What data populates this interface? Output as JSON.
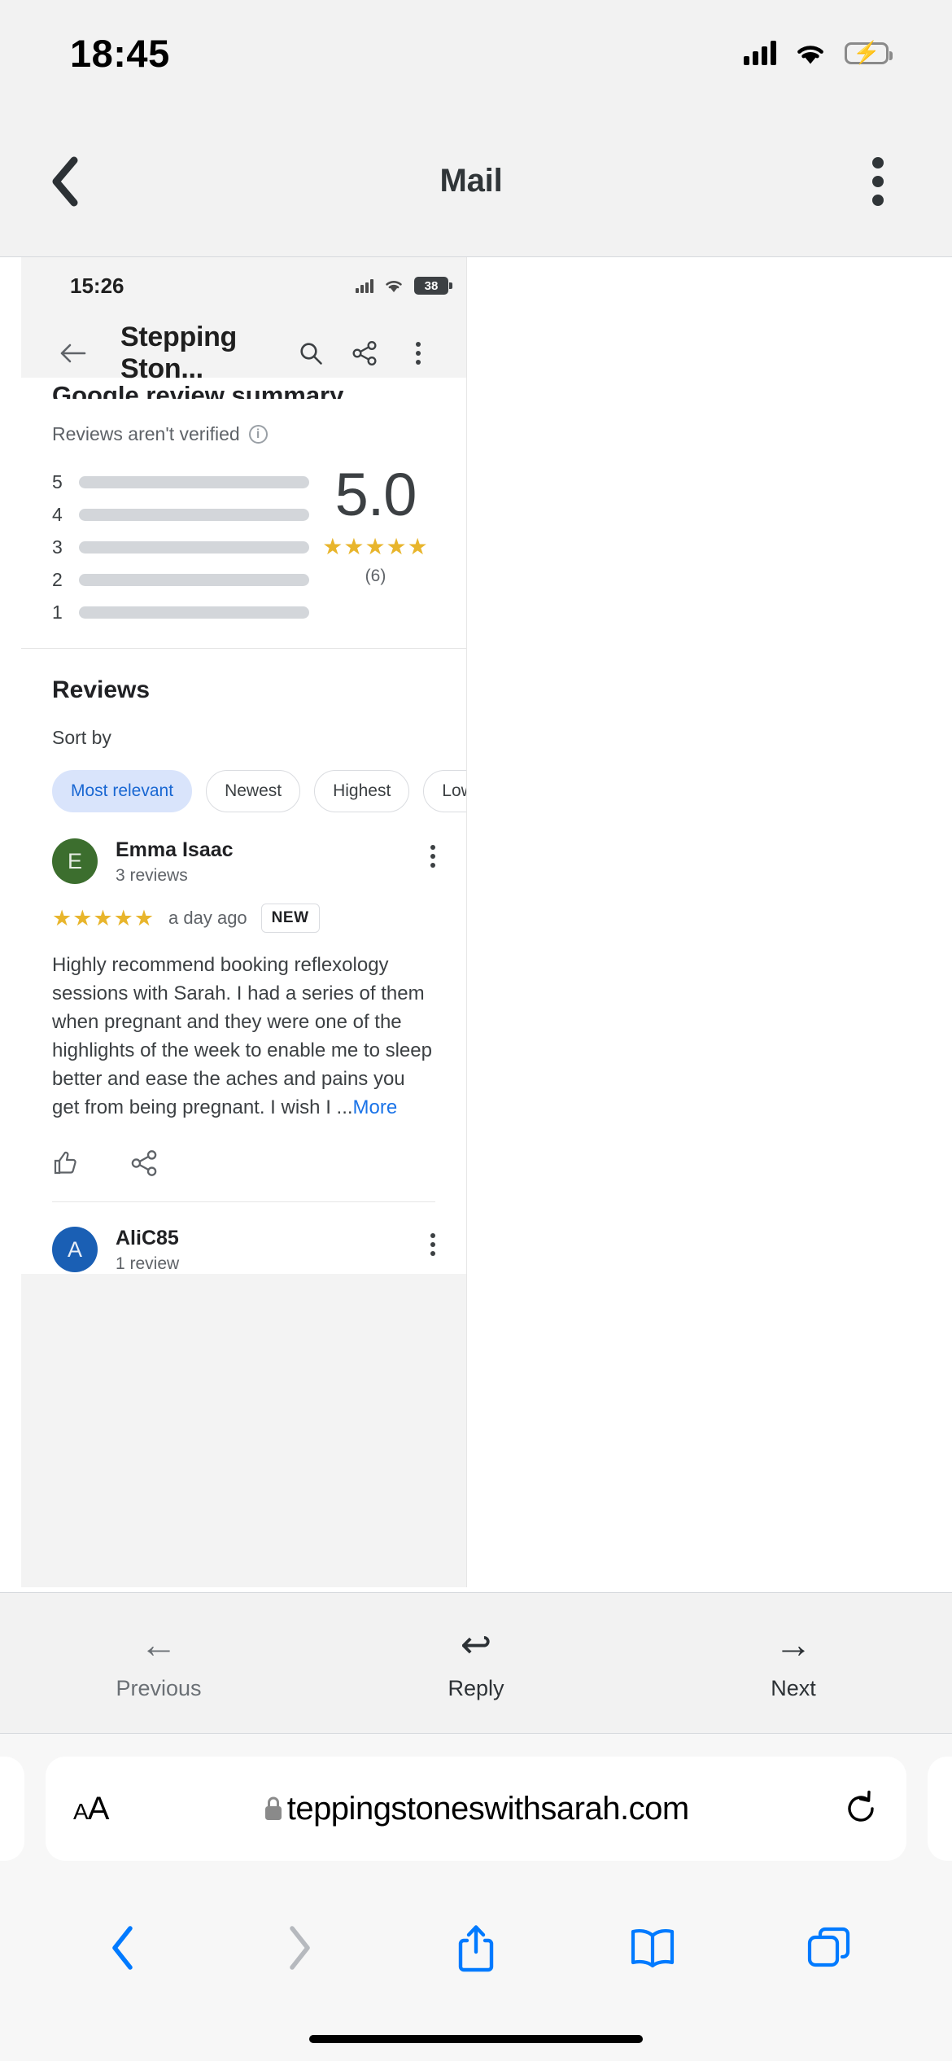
{
  "status_bar": {
    "time": "18:45",
    "signal_icon": "cellular-signal-icon",
    "wifi_icon": "wifi-icon",
    "battery_icon": "battery-charging-icon",
    "battery_bolt": "⚡"
  },
  "nav": {
    "back_icon": "chevron-left-icon",
    "title": "Mail",
    "menu_icon": "more-vertical-icon"
  },
  "attachment": {
    "status": {
      "time": "15:26",
      "battery_level": "38"
    },
    "browser": {
      "back_icon": "arrow-left-icon",
      "title": "Stepping Ston...",
      "search_icon": "search-icon",
      "share_icon": "share-icon",
      "menu_icon": "more-vertical-icon"
    },
    "summary": {
      "heading": "Google review summary",
      "verified_note": "Reviews aren't verified",
      "info_icon": "info-icon",
      "score": "5.0",
      "stars": "★★★★★",
      "count": "(6)"
    },
    "reviews_section": {
      "heading": "Reviews",
      "sort_label": "Sort by",
      "chips": [
        {
          "label": "Most relevant",
          "selected": true
        },
        {
          "label": "Newest",
          "selected": false
        },
        {
          "label": "Highest",
          "selected": false
        },
        {
          "label": "Lowest",
          "selected": false
        }
      ],
      "items": [
        {
          "initial": "E",
          "name": "Emma Isaac",
          "review_count": "3 reviews",
          "stars": "★★★★★",
          "time": "a day ago",
          "badge": "NEW",
          "text": "Highly recommend booking reflexology sessions with Sarah. I had a series of them when pregnant and they were one of the highlights of the week to enable me to sleep better and ease the aches and pains you get from being pregnant. I wish I ...",
          "more_label": "More",
          "like_icon": "thumbs-up-icon",
          "share_icon": "share-icon",
          "kebab_icon": "more-vertical-icon"
        },
        {
          "initial": "A",
          "name": "AliC85",
          "review_count": "1 review",
          "kebab_icon": "more-vertical-icon"
        }
      ]
    }
  },
  "mail_toolbar": {
    "items": [
      {
        "icon": "arrow-left-icon",
        "glyph": "←",
        "label": "Previous",
        "emphasis": false
      },
      {
        "icon": "reply-icon",
        "glyph": "↩",
        "label": "Reply",
        "emphasis": true
      },
      {
        "icon": "arrow-right-icon",
        "glyph": "→",
        "label": "Next",
        "emphasis": true
      }
    ]
  },
  "safari": {
    "text_size_label": "A",
    "text_size_label_small": "A",
    "lock_icon": "lock-icon",
    "url": "teppingstoneswithsarah.com",
    "reload_icon": "reload-icon",
    "tabs": [
      {
        "icon": "back-chevron-icon",
        "glyph": "‹",
        "dim": false
      },
      {
        "icon": "forward-chevron-icon",
        "glyph": "›",
        "dim": true
      },
      {
        "icon": "share-icon",
        "glyph": "",
        "dim": false
      },
      {
        "icon": "bookmarks-icon",
        "glyph": "",
        "dim": false
      },
      {
        "icon": "tabs-icon",
        "glyph": "",
        "dim": false
      }
    ]
  },
  "colors": {
    "accent_blue": "#007aff",
    "star_gold": "#e8b52c",
    "chip_selected_bg": "#d9e4fb",
    "chip_selected_text": "#1967d2",
    "link_blue": "#1a73e8",
    "avatar_green": "#3c6e2e",
    "avatar_blue": "#1a5fb4"
  }
}
